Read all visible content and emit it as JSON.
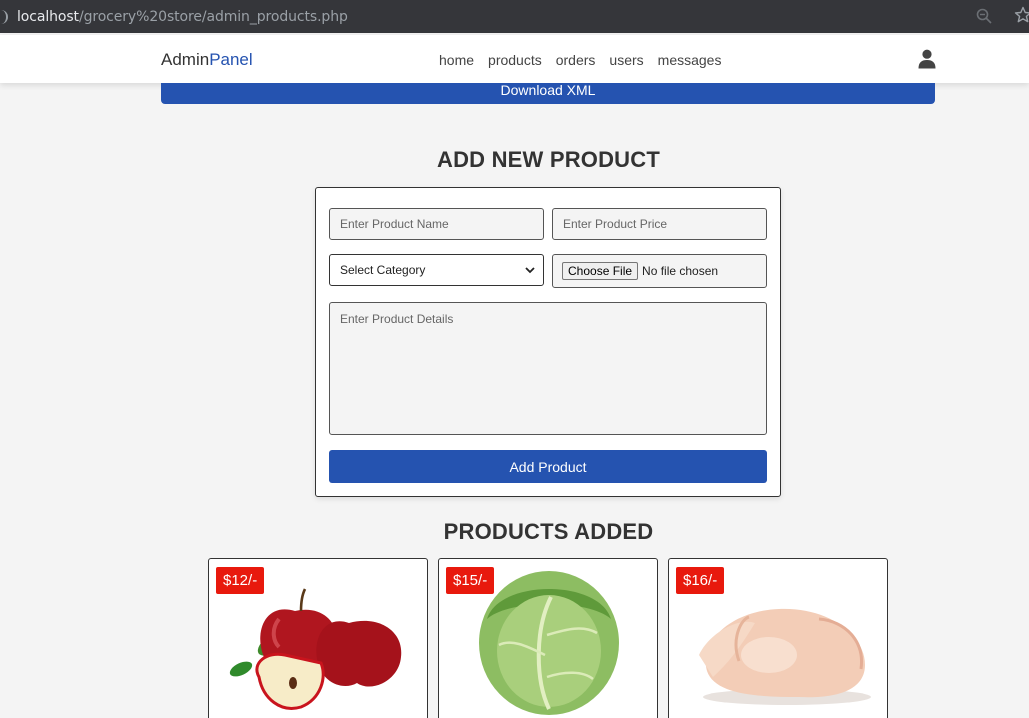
{
  "browser": {
    "url_host": "localhost",
    "url_path": "/grocery%20store/admin_products.php"
  },
  "header": {
    "logo_main": "Admin",
    "logo_accent": "Panel",
    "nav": [
      "home",
      "products",
      "orders",
      "users",
      "messages"
    ],
    "accent_color": "#2553b0"
  },
  "download_label": "Download XML",
  "add_section": {
    "title": "ADD NEW PRODUCT",
    "name_placeholder": "Enter Product Name",
    "price_placeholder": "Enter Product Price",
    "category_selected": "Select Category",
    "file_button": "Choose File",
    "file_status": "No file chosen",
    "details_placeholder": "Enter Product Details",
    "submit_label": "Add Product"
  },
  "products_section": {
    "title": "PRODUCTS ADDED",
    "products": [
      {
        "price": "$12/-",
        "image": "apples-image"
      },
      {
        "price": "$15/-",
        "image": "cabbage-image"
      },
      {
        "price": "$16/-",
        "image": "chicken-image"
      }
    ],
    "price_badge_color": "#e8190d"
  }
}
